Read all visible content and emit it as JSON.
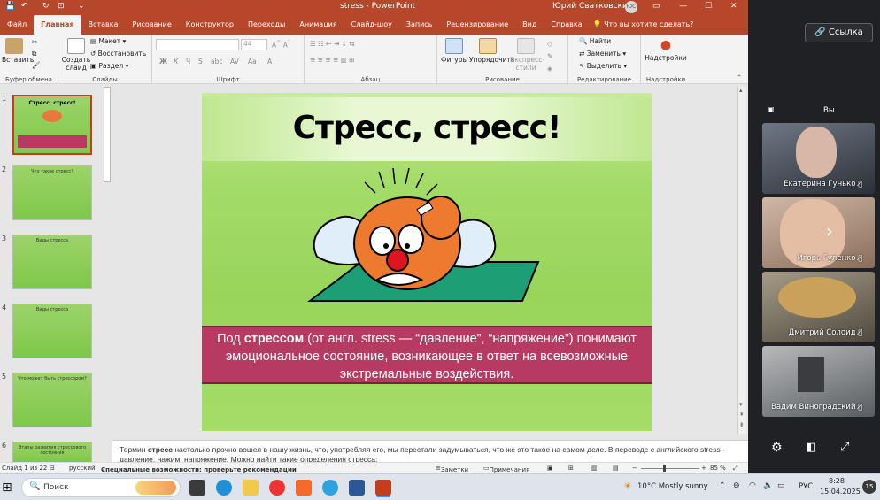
{
  "titlebar": {
    "filename": "stress",
    "app_name": "PowerPoint",
    "user_name": "Юрий Сватковский",
    "user_initials": "ЮС"
  },
  "tabs": [
    "Файл",
    "Главная",
    "Вставка",
    "Рисование",
    "Конструктор",
    "Переходы",
    "Анимация",
    "Слайд-шоу",
    "Запись",
    "Рецензирование",
    "Вид",
    "Справка"
  ],
  "tell_me": "Что вы хотите сделать?",
  "ribbon": {
    "paste": "Вставить",
    "create_slide": "Создать слайд",
    "layout": "Макет",
    "reset": "Восстановить",
    "section": "Раздел",
    "font_size": "44",
    "shapes": "Фигуры",
    "arrange": "Упорядочить",
    "express_styles": "Экспресс-стили",
    "find": "Найти",
    "replace": "Заменить",
    "select": "Выделить",
    "addins": "Надстройки",
    "groups": {
      "clipboard": "Буфер обмена",
      "slides": "Слайды",
      "font": "Шрифт",
      "paragraph": "Абзац",
      "drawing": "Рисование",
      "editing": "Редактирование",
      "addins": "Надстройки"
    }
  },
  "thumbnails": [
    {
      "num": "1",
      "title": "Стресс, стресс!"
    },
    {
      "num": "2",
      "title": "Что такое стресс?"
    },
    {
      "num": "3",
      "title": "Виды стресса"
    },
    {
      "num": "4",
      "title": "Виды стресса"
    },
    {
      "num": "5",
      "title": "Что может быть стрессором?"
    },
    {
      "num": "6",
      "title": "Этапы развития стрессового состояния"
    }
  ],
  "slide": {
    "title": "Стресс, стресс!",
    "body_prefix": "Под ",
    "body_bold": "стрессом",
    "body_rest": " (от англ. stress — “давление”, “напряжение”) понимают эмоциональное состояние, возникающее в ответ на всевозможные экстремальные воздействия."
  },
  "notes": {
    "prefix": "Термин ",
    "bold": "стресс",
    "rest": " настолько прочно вошел в нашу жизнь, что, употребляя его, мы перестали задумываться, что же это такое на самом деле. В переводе с английского stress - давление, нажим, напряжение. Можно найти такие определения стресса:"
  },
  "status": {
    "slide_info": "Слайд 1 из 22",
    "language": "русский",
    "accessibility": "Специальные возможности: проверьте рекомендации",
    "notes_btn": "Заметки",
    "comments_btn": "Примечания",
    "zoom": "85 %"
  },
  "meet": {
    "copy_link": "Ссылка",
    "you": "Вы",
    "participants": [
      "Екатерина Гунько",
      "Игорь Гуленко",
      "Дмитрий Солоид",
      "Вадим Виноградский"
    ]
  },
  "taskbar": {
    "search": "Поиск",
    "weather": "10°C  Mostly sunny",
    "lang": "РУС",
    "time": "8:28",
    "date": "15.04.2025"
  },
  "colors": {
    "accent": "#b7472a",
    "slide_box": "#b73a63",
    "slide_green": "#9cd55e"
  }
}
